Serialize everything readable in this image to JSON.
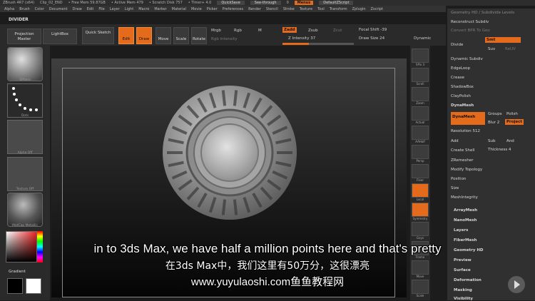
{
  "titlebar": {
    "app": "ZBrush 4R7 (x64)",
    "doc": "Clip_02_END",
    "free_mem": "• Free Mem 59.87GB",
    "active_mem": "• Active Mem 479",
    "scratch": "• Scratch Disk 757",
    "timer": "• Timer+ 4.0",
    "quicksave": "QuickSave",
    "seethrough": "See-through",
    "seethrough_val": "0",
    "menus": "Menus",
    "defaultscript": "DefaultZScript"
  },
  "menubar": [
    "Alpha",
    "Brush",
    "Color",
    "Document",
    "Draw",
    "Edit",
    "File",
    "Layer",
    "Light",
    "Macro",
    "Marker",
    "Material",
    "Movie",
    "Picker",
    "Preferences",
    "Render",
    "Stencil",
    "Stroke",
    "Texture",
    "Tool",
    "Transform",
    "Zplugin",
    "Zscript"
  ],
  "divider_label": "DIVIDER",
  "shelf": {
    "projection_master": "Projection Master",
    "lightbox": "LightBox",
    "quick_sketch": "Quick Sketch",
    "edit": "Edit",
    "draw": "Draw",
    "move": "Move",
    "scale": "Scale",
    "rotate": "Rotate",
    "mrgb": "Mrgb",
    "rgb": "Rgb",
    "m": "M",
    "rgb_intensity": "Rgb Intensity",
    "zadd": "Zadd",
    "zsub": "Zsub",
    "zcut": "Zcut",
    "z_intensity": "Z Intensity 37",
    "z_intensity_pct": 37,
    "focal_shift": "Focal Shift -39",
    "draw_size": "Draw Size 24",
    "dynamic": "Dynamic"
  },
  "left_panel": {
    "thumb1_label": "SPhere",
    "thumb2_label": "Dots",
    "thumb3_label": "Alpha Off",
    "thumb4_label": "Texture Off",
    "thumb5_label": "MatCap Metallic",
    "gradient": "Gradient"
  },
  "right_tools": [
    {
      "label": "SPix 3"
    },
    {
      "label": "Scroll"
    },
    {
      "label": "Zoom"
    },
    {
      "label": "Actual"
    },
    {
      "label": "AAHalf"
    },
    {
      "label": "Persp"
    },
    {
      "label": "Floor"
    },
    {
      "label": "Local"
    },
    {
      "label": "Symmetry"
    },
    {
      "label": "Gxyz"
    },
    {
      "label": "Frame"
    },
    {
      "label": "Move"
    },
    {
      "label": "Scale"
    }
  ],
  "tool_panel": {
    "header": "Geometry HD / Subdivide Levels",
    "reconstruct": "Reconstruct Subdiv",
    "convert_bpr": "Convert BPR To Geo",
    "divide": "Divide",
    "smt": "Smt",
    "suv": "Suv",
    "reuv": "ReUV",
    "dynamic_subdiv": "Dynamic Subdiv",
    "edgeloop": "EdgeLoop",
    "crease": "Crease",
    "shadowbox": "ShadowBox",
    "claypolish": "ClayPolish",
    "dynamesh_header": "DynaMesh",
    "dynamesh_btn": "DynaMesh",
    "groups": "Groups",
    "polish": "Polish",
    "blur": "Blur 2",
    "project": "Project",
    "resolution": "Resolution 512",
    "add": "Add",
    "sub": "Sub",
    "and": "And",
    "create_shell": "Create Shell",
    "thickness": "Thickness 4",
    "zremesher": "ZRemesher",
    "modify_topology": "Modify Topology",
    "position": "Position",
    "size": "Size",
    "meshintegrity": "MeshIntegrity",
    "arraymesh": "ArrayMesh",
    "nanomesh": "NanoMesh",
    "layers": "Layers",
    "fibermesh": "FiberMesh",
    "geometry_hd": "Geometry HD",
    "preview": "Preview",
    "surface": "Surface",
    "deformation": "Deformation",
    "masking": "Masking",
    "visibility": "Visibility"
  },
  "subtitles": {
    "english": "in to 3ds Max, we have half a million points here and that's pretty",
    "chinese": "在3ds Max中，我们这里有50万分，这很漂亮",
    "watermark": "www.yuyulaoshi.com鱼鱼教程网"
  },
  "colors": {
    "accent": "#e46a1c",
    "bg": "#1c1c1c",
    "panel": "#303030"
  }
}
